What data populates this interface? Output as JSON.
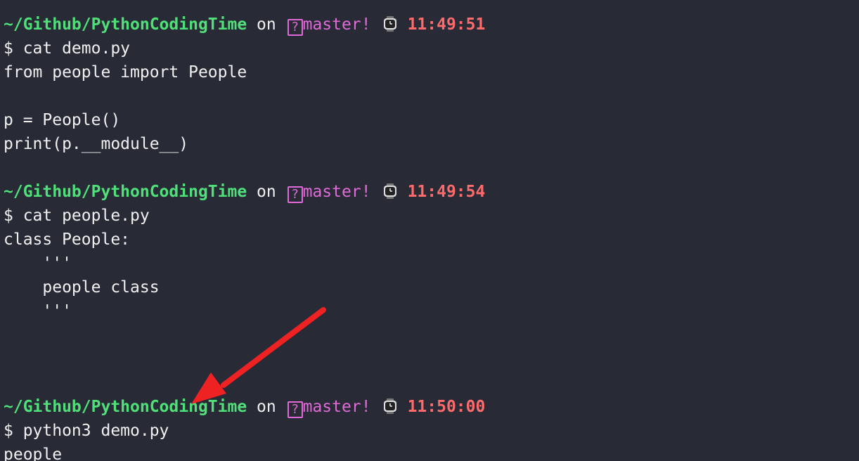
{
  "prompt": {
    "path": "~/Github/PythonCodingTime",
    "on": "on",
    "git_status_symbol": "?",
    "branch": "master",
    "dirty_marker": "!",
    "clock_icon": "watch-icon"
  },
  "blocks": [
    {
      "time": "11:49:51",
      "command": "$ cat demo.py",
      "output": [
        "from people import People",
        "",
        "p = People()",
        "print(p.__module__)",
        ""
      ]
    },
    {
      "time": "11:49:54",
      "command": "$ cat people.py",
      "output": [
        "class People:",
        "    '''",
        "    people class",
        "    '''",
        "",
        "",
        ""
      ]
    },
    {
      "time": "11:50:00",
      "command": "$ python3 demo.py",
      "output": [
        "people"
      ]
    }
  ],
  "annotation": {
    "arrow_color": "#ee2222"
  }
}
